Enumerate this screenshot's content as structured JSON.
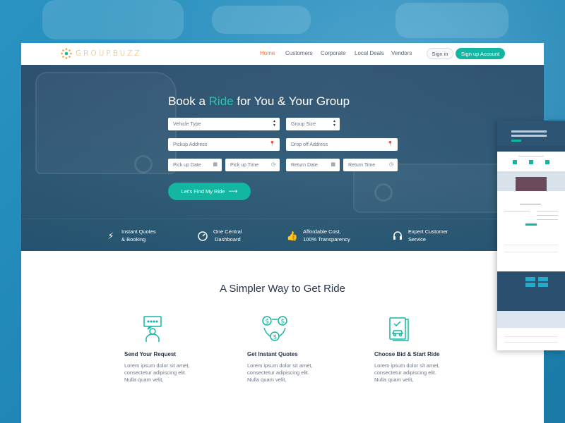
{
  "brand": {
    "name": "GROUPBUZZ",
    "accent": "#f2a33a"
  },
  "nav": {
    "home": "Home",
    "customers": "Customers",
    "corporate": "Corporate",
    "local_deals": "Local Deals",
    "vendors": "Vendors",
    "signin": "Sign in",
    "signup": "Sign up Account"
  },
  "colors": {
    "primary": "#13b6a1",
    "active_nav": "#f0772f",
    "hero_overlay": "#2b4f6e"
  },
  "hero": {
    "title_pre": "Book a ",
    "title_accent": "Ride",
    "title_post": " for You & Your Group",
    "fields": {
      "vehicle_type": "Vehicle Type",
      "group_size": "Group Size",
      "pickup_address": "Pickup Address",
      "dropoff_address": "Drop off Address",
      "pickup_date": "Pick up Date",
      "pickup_time": "Pick up Time",
      "return_date": "Return Date",
      "return_time": "Return Time"
    },
    "cta": "Let's Find My Ride"
  },
  "features": [
    {
      "line1": "Instant Quotes",
      "line2": "& Booking",
      "icon": "lightning-icon"
    },
    {
      "line1": "One Central",
      "line2": "Dashboard",
      "icon": "gauge-icon"
    },
    {
      "line1": "Affordable Cost,",
      "line2": "100% Transparency",
      "icon": "thumbs-up-icon"
    },
    {
      "line1": "Expert Customer",
      "line2": "Service",
      "icon": "headphones-icon"
    }
  ],
  "section": {
    "title": "A Simpler Way to Get Ride"
  },
  "steps": [
    {
      "title": "Send Your Request",
      "l1": "Lorem ipsum dolor sit amet,",
      "l2": "consectetur adipiscing elit.",
      "l3": "Nulla quam velit,",
      "icon": "person-chat-icon"
    },
    {
      "title": "Get Instant Quotes",
      "l1": "Lorem ipsum dolor sit amet,",
      "l2": "consectetur adipiscing elit.",
      "l3": "Nulla quam velit,",
      "icon": "dollar-exchange-icon"
    },
    {
      "title": "Choose Bid & Start Ride",
      "l1": "Lorem ipsum dolor sit amet,",
      "l2": "consectetur adipiscing elit.",
      "l3": "Nulla quam velit,",
      "icon": "document-car-icon"
    }
  ]
}
